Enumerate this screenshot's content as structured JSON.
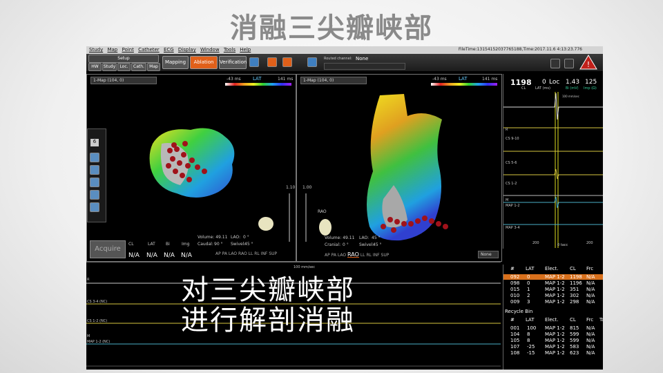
{
  "slide": {
    "title": "消融三尖瓣峡部",
    "overlay_lines": [
      "对三尖瓣峡部",
      "进行解剖消融"
    ]
  },
  "menu": {
    "items": [
      "Study",
      "Map",
      "Point",
      "Catheter",
      "ECG",
      "Display",
      "Window",
      "Tools",
      "Help"
    ],
    "file_info": "FileTime:1315415203776518​8,Time:2017.11.6 4:13:23.776"
  },
  "toolbar": {
    "setup_label": "Setup",
    "setup_tabs": [
      "HW",
      "Study",
      "Loc.",
      "Cath.",
      "Map"
    ],
    "mapping": "Mapping",
    "ablation": "Ablation",
    "verification": "Verification",
    "routed_channel_label": "Routed channel:",
    "routed_channel_value": "None"
  },
  "map_left": {
    "header": "1-Map (104, 0)",
    "lat_min": "-43 ms",
    "lat_label": "LAT",
    "lat_max": "141 ms",
    "scale": "1.10",
    "acquire": "Acquire",
    "readout_headers": [
      "CL",
      "LAT",
      "Bi",
      "Img"
    ],
    "readout_values": [
      "N/A",
      "N/A",
      "N/A",
      "N/A"
    ],
    "volume": "Volume: 49.11",
    "lao": "LAO:",
    "lao_val": "0 °",
    "caudal": "Caudal:",
    "caudal_val": "90 °",
    "swivel": "Swivel:",
    "swivel_val": "45 °",
    "counter": "6",
    "views": [
      "AP",
      "PA",
      "LAO",
      "RAO",
      "LL",
      "RL",
      "INF",
      "SUP"
    ]
  },
  "map_right": {
    "header": "1-Map (104, 0)",
    "lat_min": "-43 ms",
    "lat_label": "LAT",
    "lat_max": "141 ms",
    "scale": "1.00",
    "orient_label": "RAO",
    "volume": "Volume: 49.11",
    "lao": "LAO:",
    "lao_val": "45 °",
    "cranial": "Cranial:",
    "cranial_val": "0 °",
    "swivel": "Swivel:",
    "swivel_val": "45 °",
    "none_select": "None",
    "views": [
      "AP",
      "PA",
      "LAO",
      "RAO",
      "LL",
      "RL",
      "INF",
      "SUP"
    ]
  },
  "ecg_right": {
    "cl_value": "1198",
    "cl_label": "CL",
    "lat_value": "0",
    "lat_label": "LAT (ms)",
    "loc_label": "Loc",
    "bi_value": "1.43",
    "bi_label": "Bi (mV)",
    "imp_value": "125",
    "imp_label": "Imp (Ω)",
    "channels": [
      "R",
      "CS 9-10",
      "CS 5-6",
      "CS 1-2",
      "M",
      "MAP 1-2",
      "MAP 3-4"
    ],
    "speed": "100 mm/sec",
    "ticks": [
      "200",
      "0 tacc",
      "200"
    ]
  },
  "ecg_bottom": {
    "speed": "100 mm/sec",
    "channels": [
      "R",
      "CS 3-4 (NC)",
      "CS 1-2 (NC)",
      "M",
      "MAP 1-2 (NC)"
    ]
  },
  "points_table": {
    "headers": [
      "#",
      "LAT",
      "Elect.",
      "CL",
      "Frc"
    ],
    "rows": [
      [
        "092",
        "0",
        "MAP 1-2",
        "1198",
        "N/A"
      ],
      [
        "098",
        "0",
        "MAP 1-2",
        "1196",
        "N/A"
      ],
      [
        "015",
        "1",
        "MAP 1-2",
        "351",
        "N/A"
      ],
      [
        "010",
        "2",
        "MAP 1-2",
        "302",
        "N/A"
      ],
      [
        "009",
        "3",
        "MAP 1-2",
        "298",
        "N/A"
      ]
    ]
  },
  "recycle_bin": {
    "title": "Recycle Bin",
    "headers": [
      "#",
      "LAT",
      "Elect.",
      "CL",
      "Frc",
      "Ta"
    ],
    "rows": [
      [
        "001",
        "100",
        "MAP 1-2",
        "815",
        "N/A"
      ],
      [
        "104",
        "8",
        "MAP 1-2",
        "599",
        "N/A"
      ],
      [
        "105",
        "8",
        "MAP 1-2",
        "599",
        "N/A"
      ],
      [
        "107",
        "-25",
        "MAP 1-2",
        "583",
        "N/A"
      ],
      [
        "108",
        "-15",
        "MAP 1-2",
        "623",
        "N/A"
      ]
    ]
  },
  "colors": {
    "ablation": "#e0601a",
    "selected_row": "#d8701c",
    "lesion": "#b0131a"
  }
}
